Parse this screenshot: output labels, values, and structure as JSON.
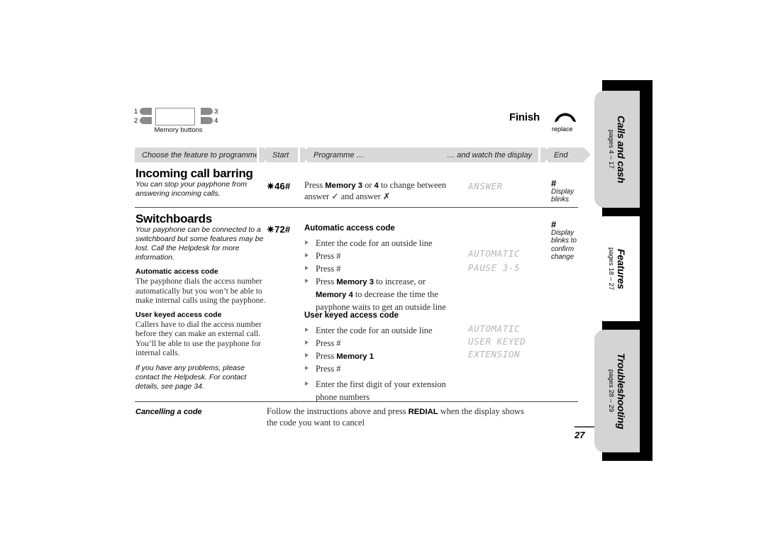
{
  "diagram": {
    "caption": "Memory buttons",
    "labels": {
      "one": "1",
      "two": "2",
      "three": "3",
      "four": "4"
    }
  },
  "finish": {
    "label": "Finish",
    "icon": "handset-replace-icon",
    "caption": "replace"
  },
  "flow": {
    "steps": [
      {
        "label": "Choose the feature to programme"
      },
      {
        "label": "Start"
      },
      {
        "label": "Programme …"
      },
      {
        "label": "… and watch the display"
      },
      {
        "label": "End"
      }
    ]
  },
  "sections": [
    {
      "title": "Incoming call barring",
      "intro": "You can stop your payphone from answering incoming calls.",
      "code": "✷46#",
      "instructions": [
        {
          "type": "para",
          "html": "Press <b>Memory 3</b> or <b>4</b> to change between answer ✓ and answer ✗"
        }
      ],
      "lcd": [
        "ANSWER"
      ],
      "note": {
        "symbol": "#",
        "text": "Display blinks"
      }
    },
    {
      "title": "Switchboards",
      "intro": "Your payphone can be connected to a switchboard but some features may be lost. Call the Helpdesk for more information.",
      "code": "✷72#",
      "subsections": [
        {
          "heading": "Automatic access code",
          "blurb": "The payphone dials the access number automatically but you won’t be able to make internal calls using the payphone."
        },
        {
          "heading": "User keyed access code",
          "blurb": "Callers have to dial the access number before they can make an external call. You’ll be able to use the payphone for internal calls."
        }
      ],
      "helpdesk": "If you have any problems, please contact the Helpdesk. For contact details, see page 34.",
      "group_a": {
        "heading": "Automatic access code",
        "steps": [
          "Enter the code for an outside line",
          "Press #",
          "Press #",
          "Press <b>Memory 3</b> to increase, or <b>Memory 4</b> to decrease the time the payphone waits to get an outside line"
        ],
        "lcd": [
          "AUTOMATIC",
          "PAUSE 3-5"
        ]
      },
      "group_b": {
        "heading": "User keyed access code",
        "steps": [
          "Enter the code for an outside line",
          "Press #",
          "Press <b>Memory 1</b>",
          "Press #",
          "Enter the first digit of your extension phone numbers"
        ],
        "lcd": [
          "AUTOMATIC",
          "USER KEYED",
          "EXTENSION"
        ]
      },
      "note": {
        "symbol": "#",
        "text": "Display blinks to confirm change"
      }
    }
  ],
  "cancelling": {
    "label": "Cancelling a code",
    "body_html": "Follow the instructions above and press <b>REDIAL</b> when the display shows the code you want to cancel"
  },
  "page_number": "27",
  "tabs": [
    {
      "title": "Calls and cash",
      "pages": "pages 4 – 17",
      "state": "gray"
    },
    {
      "title": "Features",
      "pages": "pages 18 – 27",
      "state": "white"
    },
    {
      "title": "Troubleshooting",
      "pages": "pages 28 – 29",
      "state": "gray"
    }
  ],
  "colors": {
    "flow_bg": "#d9d9d9",
    "lcd_text": "#b4b4b4",
    "sidebar_bg": "#000000",
    "tab_gray": "#d4d4d4",
    "tab_active": "#ffffff"
  }
}
